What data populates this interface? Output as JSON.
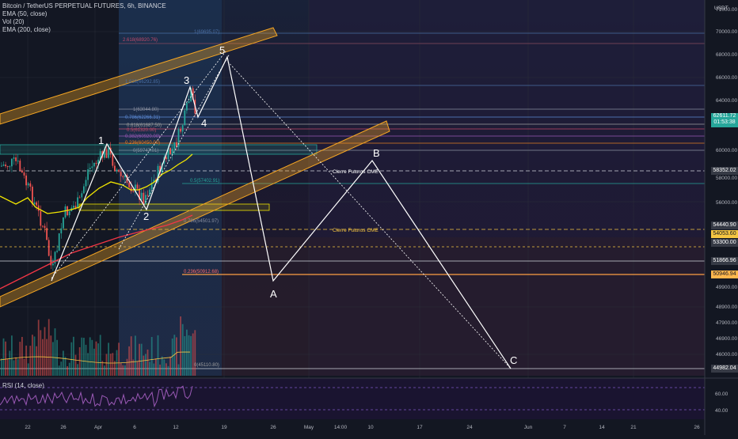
{
  "header": {
    "symbol": "Bitcoin / TetherUS PERPETUAL FUTURES, 6h, BINANCE",
    "indicators": [
      "EMA (50, close)",
      "Vol (20)",
      "EMA (200, close)"
    ],
    "currency": "USDT"
  },
  "rsi": {
    "label": "RSI (14, close)",
    "ticks": [
      "60.00",
      "40.00"
    ]
  },
  "price_axis": {
    "ticks": [
      "71000.00",
      "70000.00",
      "68000.00",
      "66000.00",
      "64000.00",
      "62000.00",
      "60000.00",
      "58000.00",
      "56000.00",
      "54000.00",
      "53000.00",
      "51000.00",
      "49900.00",
      "48900.00",
      "47900.00",
      "46900.00",
      "46000.00"
    ],
    "markers": [
      {
        "text": "62611.72",
        "sub": "01:53:38",
        "color": "#26a69a"
      },
      {
        "text": "58352.02",
        "color": "#363a45"
      },
      {
        "text": "54440.90",
        "color": "#363a45"
      },
      {
        "text": "54053.60",
        "color": "#f5c542"
      },
      {
        "text": "53300.00",
        "color": "#363a45"
      },
      {
        "text": "51866.96",
        "color": "#363a45"
      },
      {
        "text": "50946.94",
        "color": "#ffb74d"
      },
      {
        "text": "44982.04",
        "color": "#363a45"
      }
    ]
  },
  "time_axis": [
    "22",
    "26",
    "Apr",
    "6",
    "12",
    "19",
    "26",
    "May",
    "14:00",
    "10",
    "17",
    "24",
    "Jun",
    "7",
    "14",
    "21",
    "26"
  ],
  "fib_labels": [
    "1(69695.07)",
    "2.618(68920.76)",
    "1.618(66292.85)",
    "1(63044.80)",
    "0.786(62266.31)",
    "0.618(61687.50)",
    "0.5(61320.00)",
    "0.382(60920.00)",
    "0.236(60450.00)",
    "0(59747.01)",
    "0.5(57402.91)",
    "0.786(54501.97)",
    "0.236(50912.68)",
    "0(45110.80)"
  ],
  "wave_labels": [
    "1",
    "2",
    "3",
    "4",
    "5",
    "A",
    "B",
    "C"
  ],
  "annotations": {
    "cme_white": "Cierre Futuros CME",
    "cme_yellow": "Cierre Futuros CME"
  },
  "colors": {
    "background": "#131722",
    "channel": "#f5a623",
    "wave": "#ffffff",
    "ema50": "#f2e600",
    "ema200": "#f23645",
    "up": "#26a69a",
    "down": "#ef5350"
  },
  "chart_data": {
    "type": "candlestick",
    "title": "Bitcoin / TetherUS PERPETUAL FUTURES, 6h, BINANCE",
    "price_range": [
      44982.04,
      71000
    ],
    "wave_points": [
      {
        "label": "1",
        "price": 61500
      },
      {
        "label": "2",
        "price": 55800
      },
      {
        "label": "3",
        "price": 65000
      },
      {
        "label": "4",
        "price": 62300
      },
      {
        "label": "5",
        "price": 68200
      },
      {
        "label": "A",
        "price": 50300
      },
      {
        "label": "B",
        "price": 59300
      },
      {
        "label": "C",
        "price": 44982
      }
    ],
    "current_price": 62611.72
  }
}
